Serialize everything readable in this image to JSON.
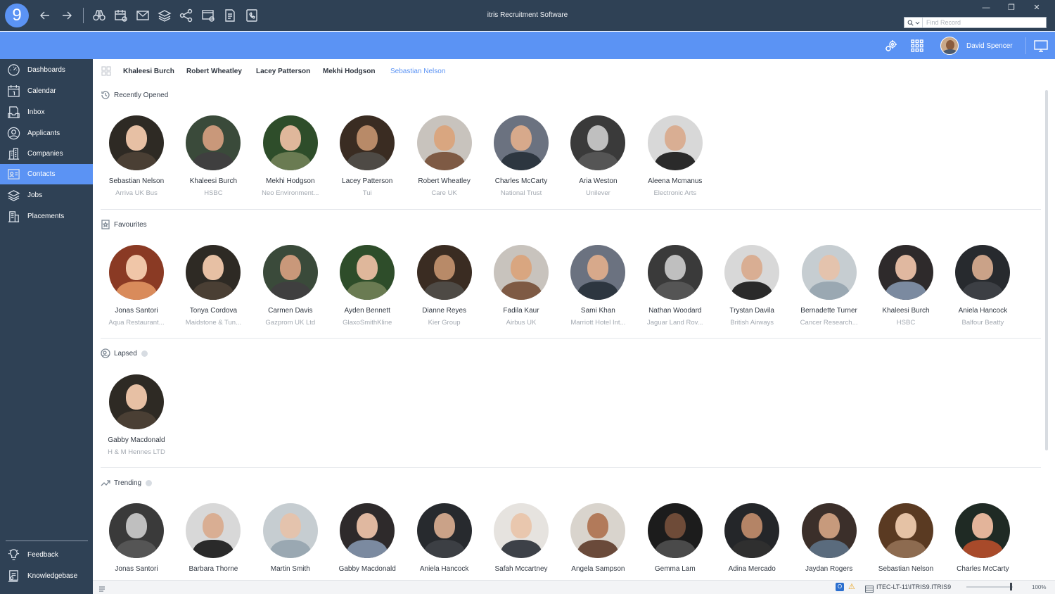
{
  "app": {
    "logo": "9",
    "title": "itris Recruitment Software",
    "find_placeholder": "Find Record",
    "window_controls": [
      "—",
      "❐",
      "✕"
    ]
  },
  "header": {
    "user_name": "David Spencer"
  },
  "sidebar": {
    "items": [
      {
        "label": "Dashboards",
        "icon": "dashboard-icon"
      },
      {
        "label": "Calendar",
        "icon": "calendar-icon"
      },
      {
        "label": "Inbox",
        "icon": "inbox-icon"
      },
      {
        "label": "Applicants",
        "icon": "applicant-icon"
      },
      {
        "label": "Companies",
        "icon": "company-icon"
      },
      {
        "label": "Contacts",
        "icon": "contacts-icon",
        "active": true
      },
      {
        "label": "Jobs",
        "icon": "jobs-icon"
      },
      {
        "label": "Placements",
        "icon": "placements-icon"
      }
    ],
    "footer_items": [
      {
        "label": "Feedback",
        "icon": "lightbulb-icon"
      },
      {
        "label": "Knowledgebase",
        "icon": "knowledgebase-icon"
      }
    ]
  },
  "tabs": [
    "Khaleesi Burch",
    "Robert Wheatley",
    "Lacey Patterson",
    "Mekhi Hodgson",
    "Sebastian Nelson"
  ],
  "sections": {
    "recent": {
      "title": "Recently Opened",
      "cards": [
        {
          "name": "Sebastian Nelson",
          "company": "Arriva UK Bus"
        },
        {
          "name": "Khaleesi Burch",
          "company": "HSBC"
        },
        {
          "name": "Mekhi Hodgson",
          "company": "Neo Environment..."
        },
        {
          "name": "Lacey Patterson",
          "company": "Tui"
        },
        {
          "name": "Robert Wheatley",
          "company": "Care UK"
        },
        {
          "name": "Charles McCarty",
          "company": "National Trust"
        },
        {
          "name": "Aria Weston",
          "company": "Unilever"
        },
        {
          "name": "Aleena Mcmanus",
          "company": "Electronic Arts"
        }
      ]
    },
    "favourites": {
      "title": "Favourites",
      "cards": [
        {
          "name": "Jonas Santori",
          "company": "Aqua Restaurant..."
        },
        {
          "name": "Tonya Cordova",
          "company": "Maidstone & Tun..."
        },
        {
          "name": "Carmen Davis",
          "company": "Gazprom UK Ltd"
        },
        {
          "name": "Ayden Bennett",
          "company": "GlaxoSmithKline"
        },
        {
          "name": "Dianne Reyes",
          "company": "Kier Group"
        },
        {
          "name": "Fadila Kaur",
          "company": "Airbus UK"
        },
        {
          "name": "Sami Khan",
          "company": "Marriott Hotel Int..."
        },
        {
          "name": "Nathan Woodard",
          "company": "Jaguar Land Rov..."
        },
        {
          "name": "Trystan Davila",
          "company": "British Airways"
        },
        {
          "name": "Bernadette Turner",
          "company": "Cancer Research..."
        },
        {
          "name": "Khaleesi Burch",
          "company": "HSBC"
        },
        {
          "name": "Aniela Hancock",
          "company": "Balfour Beatty"
        }
      ]
    },
    "lapsed": {
      "title": "Lapsed",
      "cards": [
        {
          "name": "Gabby Macdonald",
          "company": "H & M Hennes LTD"
        }
      ]
    },
    "trending": {
      "title": "Trending",
      "cards": [
        {
          "name": "Jonas Santori"
        },
        {
          "name": "Barbara Thorne"
        },
        {
          "name": "Martin Smith"
        },
        {
          "name": "Gabby Macdonald"
        },
        {
          "name": "Aniela Hancock"
        },
        {
          "name": "Safah Mccartney"
        },
        {
          "name": "Angela Sampson"
        },
        {
          "name": "Gemma Lam"
        },
        {
          "name": "Adina Mercado"
        },
        {
          "name": "Jaydan Rogers"
        },
        {
          "name": "Sebastian Nelson"
        },
        {
          "name": "Charles McCarty"
        }
      ]
    }
  },
  "status": {
    "outlook_badge": "O",
    "warning_glyph": "⚠",
    "db": "ITEC-LT-11\\ITRIS9.ITRIS9",
    "zoom": "100%",
    "zoom_level": 0.95
  },
  "colors": {
    "accent": "#5b93f4",
    "sidebar": "#2f4155"
  }
}
